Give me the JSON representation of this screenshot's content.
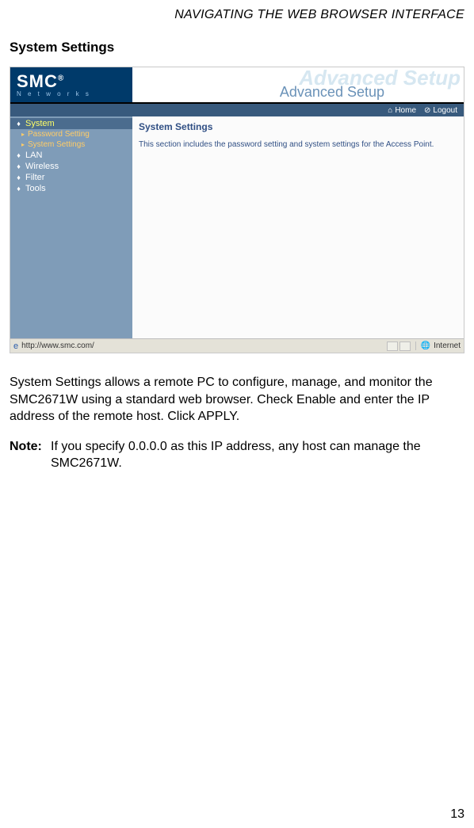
{
  "runningHead": "NAVIGATING THE WEB BROWSER INTERFACE",
  "sectionTitle": "System Settings",
  "screenshot": {
    "logo": {
      "main": "SMC",
      "reg": "®",
      "sub": "N e t w o r k s"
    },
    "ghostTitle": "Advanced Setup",
    "overlayLabel": "Advanced Setup",
    "topLinks": {
      "home": "Home",
      "logout": "Logout"
    },
    "sidebar": {
      "groups": [
        {
          "label": "System",
          "active": true
        },
        {
          "label": "LAN",
          "active": false
        },
        {
          "label": "Wireless",
          "active": false
        },
        {
          "label": "Filter",
          "active": false
        },
        {
          "label": "Tools",
          "active": false
        }
      ],
      "systemSubs": [
        "Password Setting",
        "System Settings"
      ]
    },
    "pane": {
      "heading": "System Settings",
      "text": "This section includes the password setting and system settings for the Access Point."
    },
    "status": {
      "url": "http://www.smc.com/",
      "zone": "Internet"
    }
  },
  "paragraph": "System Settings allows a remote PC to configure, manage, and monitor the SMC2671W using a standard web browser. Check Enable and enter the IP address of the remote host. Click APPLY.",
  "noteLabel": "Note:",
  "noteText": "If you specify 0.0.0.0 as this IP address, any host can manage the SMC2671W.",
  "pageNumber": "13"
}
